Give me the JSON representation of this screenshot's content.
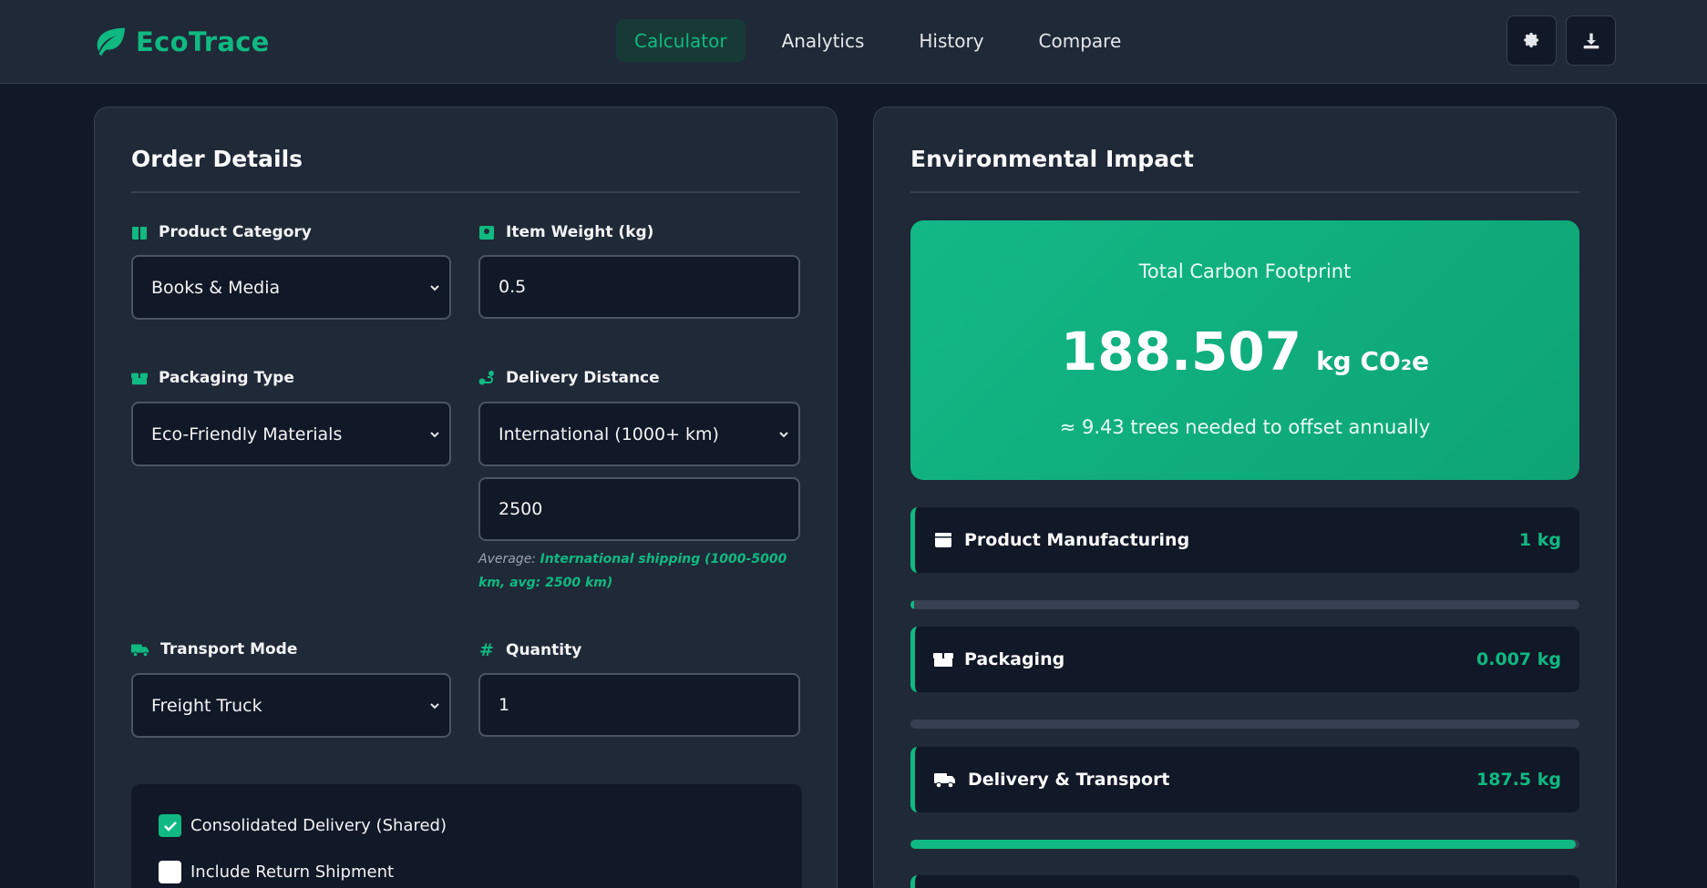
{
  "brand": {
    "name": "EcoTrace"
  },
  "nav": {
    "tabs": [
      {
        "label": "Calculator",
        "active": true
      },
      {
        "label": "Analytics"
      },
      {
        "label": "History"
      },
      {
        "label": "Compare"
      }
    ]
  },
  "toolbar": {
    "settings_icon": "gear-icon",
    "download_icon": "download-icon"
  },
  "order": {
    "title": "Order Details",
    "product_category": {
      "label": "Product Category",
      "value": "Books & Media"
    },
    "item_weight": {
      "label": "Item Weight (kg)",
      "value": "0.5"
    },
    "packaging_type": {
      "label": "Packaging Type",
      "value": "Eco-Friendly Materials"
    },
    "delivery_distance": {
      "label": "Delivery Distance",
      "value": "International (1000+ km)",
      "km_value": "2500",
      "hint_prefix": "Average:",
      "hint_text": "International shipping (1000-5000 km, avg: 2500 km)"
    },
    "transport_mode": {
      "label": "Transport Mode",
      "value": "Freight Truck"
    },
    "quantity": {
      "label": "Quantity",
      "value": "1"
    },
    "options": [
      {
        "label": "Consolidated Delivery (Shared)",
        "checked": true
      },
      {
        "label": "Include Return Shipment",
        "checked": false
      }
    ]
  },
  "impact": {
    "title": "Environmental Impact",
    "total_label": "Total Carbon Footprint",
    "total_value": "188.507",
    "total_unit": "kg CO₂e",
    "trees_text": "≈ 9.43 trees needed to offset annually",
    "breakdown": [
      {
        "name": "Product Manufacturing",
        "value": "1 kg",
        "icon": "box-icon",
        "share": 0.005
      },
      {
        "name": "Packaging",
        "value": "0.007 kg",
        "icon": "boxes-icon",
        "share": 0.0
      },
      {
        "name": "Delivery & Transport",
        "value": "187.5 kg",
        "icon": "truck-icon",
        "share": 0.995
      }
    ]
  },
  "colors": {
    "accent": "#10b981",
    "background": "#111827",
    "panel": "#1f2937"
  }
}
